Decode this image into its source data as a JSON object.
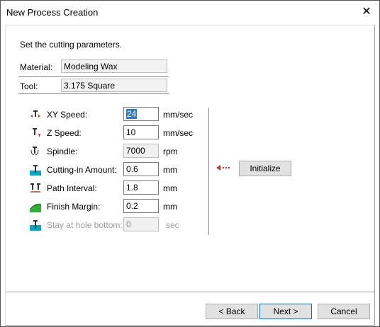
{
  "window": {
    "title": "New Process Creation"
  },
  "intro": "Set the cutting parameters.",
  "material": {
    "label": "Material:",
    "value": "Modeling Wax"
  },
  "tool": {
    "label": "Tool:",
    "value": "3.175 Square"
  },
  "params": [
    {
      "label": "XY Speed:",
      "value": "24",
      "unit": "mm/sec",
      "icon": "xy-speed-icon"
    },
    {
      "label": "Z Speed:",
      "value": "10",
      "unit": "mm/sec",
      "icon": "z-speed-icon"
    },
    {
      "label": "Spindle:",
      "value": "7000",
      "unit": "rpm",
      "icon": "spindle-icon"
    },
    {
      "label": "Cutting-in Amount:",
      "value": "0.6",
      "unit": "mm",
      "icon": "cutting-in-icon"
    },
    {
      "label": "Path Interval:",
      "value": "1.8",
      "unit": "mm",
      "icon": "path-interval-icon"
    },
    {
      "label": "Finish Margin:",
      "value": "0.2",
      "unit": "mm",
      "icon": "finish-margin-icon"
    },
    {
      "label": "Stay at hole bottom:",
      "value": "0",
      "unit": "sec",
      "icon": "stay-hole-icon"
    }
  ],
  "initialize": {
    "label": "Initialize"
  },
  "buttons": {
    "back": "< Back",
    "next": "Next >",
    "cancel": "Cancel"
  },
  "colors": {
    "accent": "#0078d7",
    "icon_red": "#c0392b",
    "icon_cyan": "#00a8c8",
    "icon_green": "#2fae3a"
  }
}
